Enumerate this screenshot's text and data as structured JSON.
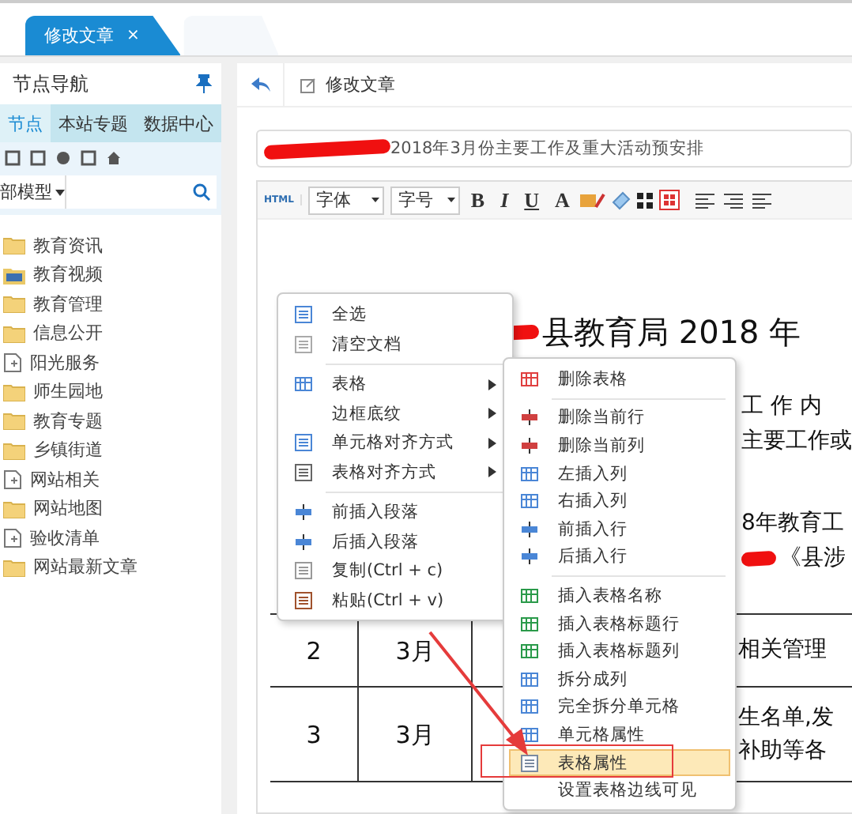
{
  "tabs": [
    {
      "label": "修改文章",
      "close": "×",
      "selected": true
    }
  ],
  "sidebar": {
    "title": "节点导航",
    "tabs": [
      {
        "label": "节点",
        "selected": true
      },
      {
        "label": "本站专题",
        "selected": false
      },
      {
        "label": "数据中心",
        "selected": false
      }
    ],
    "model_select": "部模型",
    "tree": [
      {
        "label": "教育资讯",
        "kind": "folder"
      },
      {
        "label": "教育视频",
        "kind": "media"
      },
      {
        "label": "教育管理",
        "kind": "folder"
      },
      {
        "label": "信息公开",
        "kind": "folder"
      },
      {
        "label": "阳光服务",
        "kind": "page"
      },
      {
        "label": "师生园地",
        "kind": "folder"
      },
      {
        "label": "教育专题",
        "kind": "folder"
      },
      {
        "label": "乡镇街道",
        "kind": "folder"
      },
      {
        "label": "网站相关",
        "kind": "page"
      },
      {
        "label": "网站地图",
        "kind": "folder"
      },
      {
        "label": "验收清单",
        "kind": "page"
      },
      {
        "label": "网站最新文章",
        "kind": "folder"
      }
    ]
  },
  "main": {
    "header_title": "修改文章",
    "title_field": "2018年3月份主要工作及重大活动预安排",
    "editor_toolbar": {
      "html": "HTML",
      "font": "字体",
      "size": "字号",
      "format": [
        "B",
        "I",
        "U"
      ],
      "font_color": "A"
    },
    "document": {
      "heading": "县教育局 2018 年",
      "lines": [
        {
          "text": "工 作 内",
          "redacted": false
        },
        {
          "text": "主要工作或",
          "redacted": false
        },
        {
          "text": "8年教育工",
          "redacted": false
        },
        {
          "text": "《县涉",
          "redacted": true
        }
      ]
    },
    "table": {
      "rows": [
        [
          "2",
          "3月",
          [
            "相关管理"
          ]
        ],
        [
          "3",
          "3月",
          [
            "生名单,发",
            "补助等各"
          ]
        ]
      ]
    }
  },
  "context_menu": {
    "groups": [
      [
        {
          "label": "全选",
          "submenu": false,
          "selected": false
        },
        {
          "label": "清空文档",
          "submenu": false,
          "selected": false
        }
      ],
      [
        {
          "label": "表格",
          "submenu": true,
          "selected": false
        },
        {
          "label": "边框底纹",
          "submenu": true,
          "selected": false
        },
        {
          "label": "单元格对齐方式",
          "submenu": true,
          "selected": false
        },
        {
          "label": "表格对齐方式",
          "submenu": true,
          "selected": false
        }
      ],
      [
        {
          "label": "前插入段落",
          "submenu": false,
          "selected": false
        },
        {
          "label": "后插入段落",
          "submenu": false,
          "selected": false
        },
        {
          "label": "复制(Ctrl + c)",
          "submenu": false,
          "selected": false
        },
        {
          "label": "粘贴(Ctrl + v)",
          "submenu": false,
          "selected": false
        }
      ]
    ]
  },
  "table_submenu": {
    "groups": [
      [
        {
          "label": "删除表格",
          "selected": false
        }
      ],
      [
        {
          "label": "删除当前行",
          "selected": false
        },
        {
          "label": "删除当前列",
          "selected": false
        },
        {
          "label": "左插入列",
          "selected": false
        },
        {
          "label": "右插入列",
          "selected": false
        },
        {
          "label": "前插入行",
          "selected": false
        },
        {
          "label": "后插入行",
          "selected": false
        }
      ],
      [
        {
          "label": "插入表格名称",
          "selected": false
        },
        {
          "label": "插入表格标题行",
          "selected": false
        },
        {
          "label": "插入表格标题列",
          "selected": false
        },
        {
          "label": "拆分成列",
          "selected": false
        },
        {
          "label": "完全拆分单元格",
          "selected": false
        },
        {
          "label": "单元格属性",
          "selected": false
        },
        {
          "label": "表格属性",
          "selected": true
        },
        {
          "label": "设置表格边线可见",
          "selected": false
        }
      ]
    ]
  }
}
